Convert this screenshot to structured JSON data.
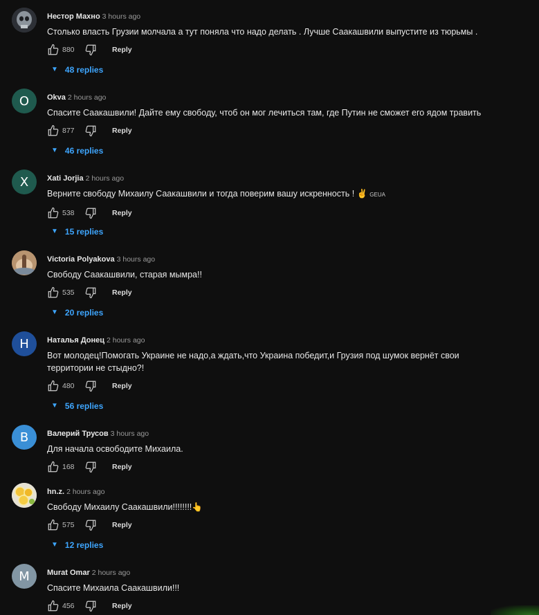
{
  "labels": {
    "reply": "Reply"
  },
  "comments": [
    {
      "author": "Нестор Махно",
      "time": "3 hours ago",
      "text": "Столько власть Грузии молчала а тут поняла что надо делать . Лучше Саакашвили выпустите из тюрьмы .",
      "likes": "880",
      "replies": "48 replies",
      "avatar_letter": "",
      "avatar_color": "#6a7078"
    },
    {
      "author": "Okva",
      "time": "2 hours ago",
      "text": "Спасите Саакашвили! Дайте ему свободу, чтоб он мог лечиться там, где Путин не сможет его ядом травить",
      "likes": "877",
      "replies": "46 replies",
      "avatar_letter": "O",
      "avatar_color": "#1f5a4e"
    },
    {
      "author": "Xati Jorjia",
      "time": "2 hours ago",
      "text": "Верните свободу Михаилу Саакашвили и тогда поверим вашу искренность !",
      "emoji": "✌",
      "flag": "GEUA",
      "likes": "538",
      "replies": "15 replies",
      "avatar_letter": "X",
      "avatar_color": "#1f5a4e"
    },
    {
      "author": "Victoria Polyakova",
      "time": "3 hours ago",
      "text": "Свободу Саакашвили, старая мымра!!",
      "likes": "535",
      "replies": "20 replies",
      "avatar_letter": "",
      "avatar_color": "#8a6a4a"
    },
    {
      "author": "Наталья Донец",
      "time": "2 hours ago",
      "text": "Вот молодец!Помогать Украине не надо,а ждать,что Украина победит,и Грузия под шумок вернёт свои территории не стыдно?!",
      "likes": "480",
      "replies": "56 replies",
      "avatar_letter": "Н",
      "avatar_color": "#1f4f9a"
    },
    {
      "author": "Валерий Трусов",
      "time": "3 hours ago",
      "text": "Для начала освободите Михаила.",
      "likes": "168",
      "replies": "",
      "avatar_letter": "В",
      "avatar_color": "#3a8fd6"
    },
    {
      "author": "hn.z.",
      "time": "2 hours ago",
      "text": "Свободу Михаилу Саакашвили!!!!!!!!",
      "emoji": "👆",
      "likes": "575",
      "replies": "12 replies",
      "avatar_letter": "",
      "avatar_color": "#d9d9d9"
    },
    {
      "author": "Murat Omar",
      "time": "2 hours ago",
      "text": "Спасите Михаила Саакашвили!!!",
      "likes": "456",
      "replies": "",
      "avatar_letter": "M",
      "avatar_color": "#8296a4"
    }
  ]
}
